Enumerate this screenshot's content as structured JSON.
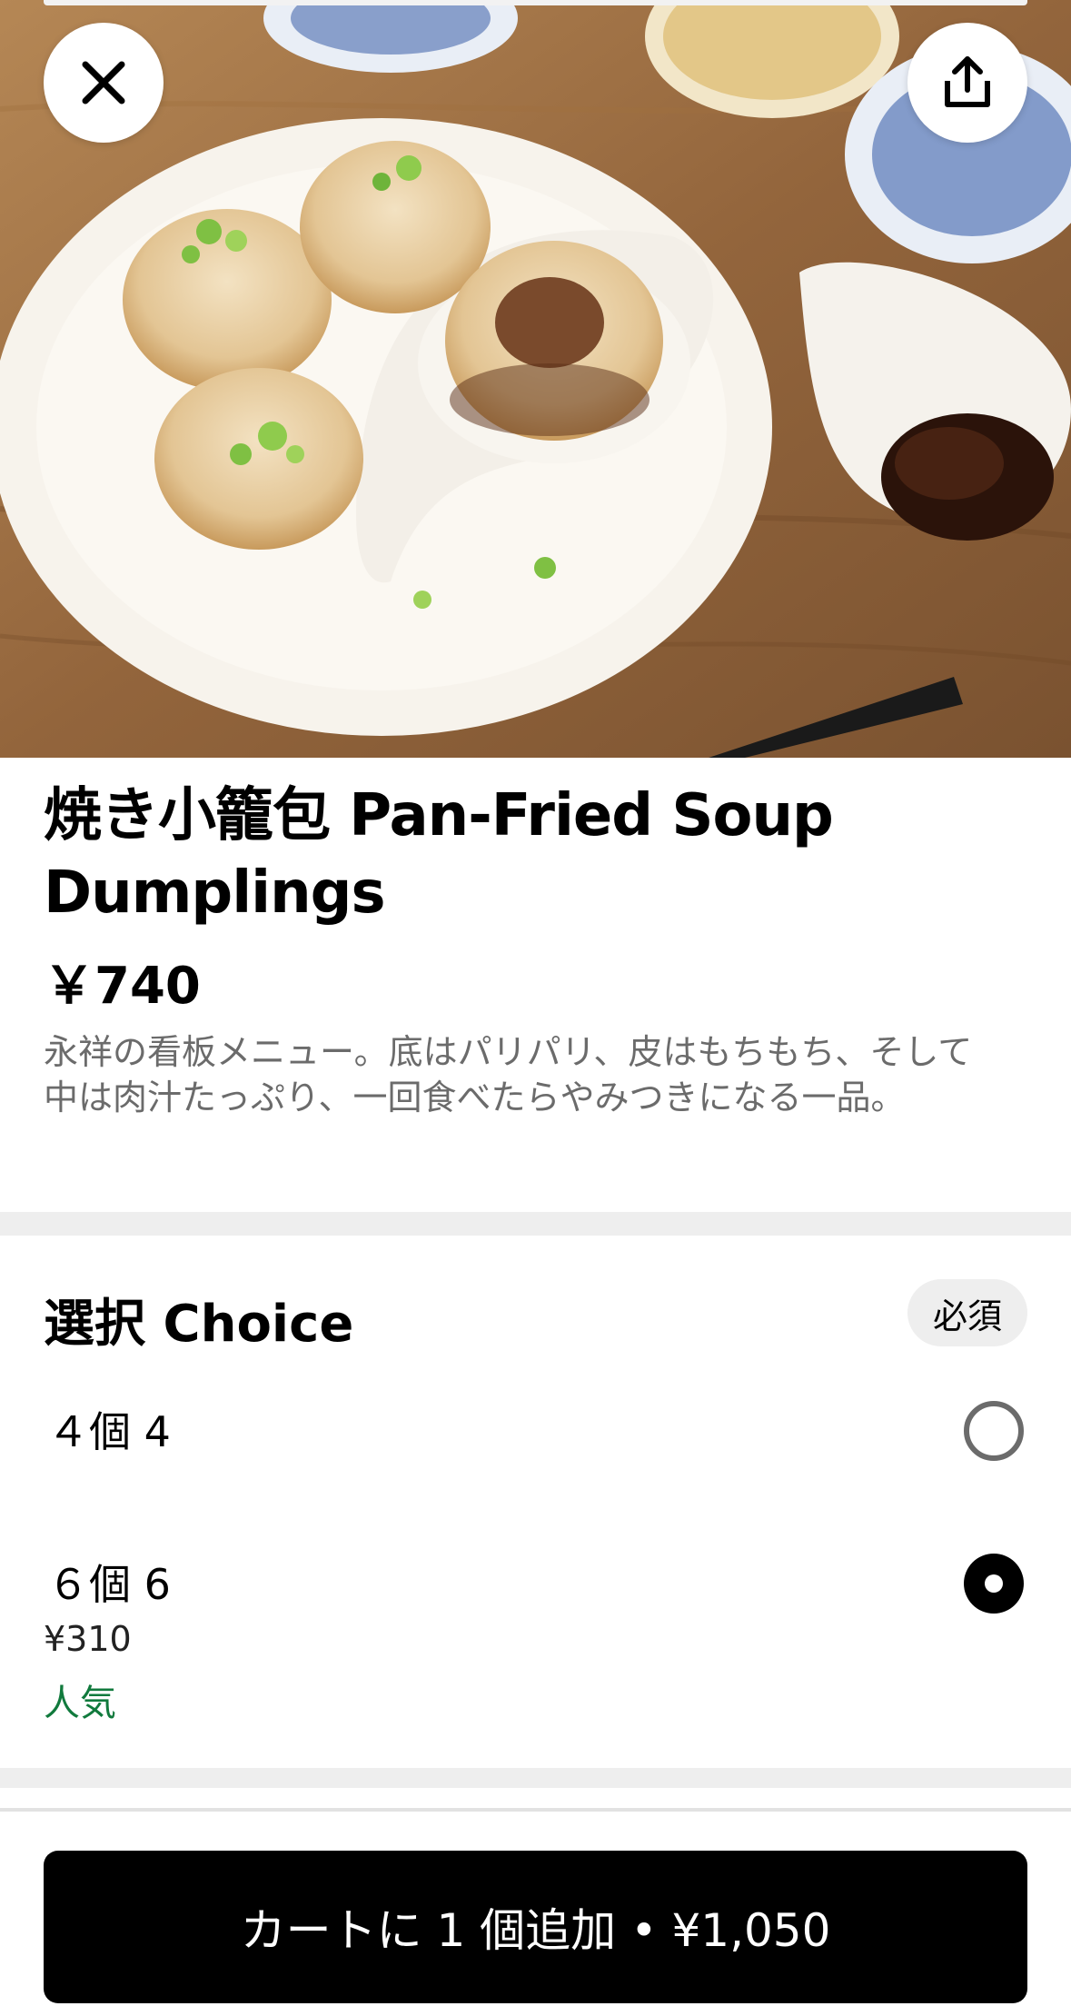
{
  "hero": {
    "close_icon": "close-icon",
    "share_icon": "share-icon"
  },
  "item": {
    "title": "焼き小籠包 Pan-Fried Soup Dumplings",
    "price": "￥740",
    "description": "永祥の看板メニュー。底はパリパリ、皮はもちもち、そして中は肉汁たっぷり、一回食べたらやみつきになる一品。"
  },
  "choice": {
    "title": "選択 Choice",
    "required_label": "必須",
    "options": [
      {
        "label": "４個 4",
        "selected": false
      },
      {
        "label": "６個 6",
        "price": "¥310",
        "badge": "人気",
        "selected": true
      }
    ]
  },
  "cart": {
    "add_label": "カートに 1 個追加 • ¥1,050"
  },
  "colors": {
    "accent": "#000000",
    "popular": "#117a3d",
    "muted_text": "#6b6b6b"
  }
}
